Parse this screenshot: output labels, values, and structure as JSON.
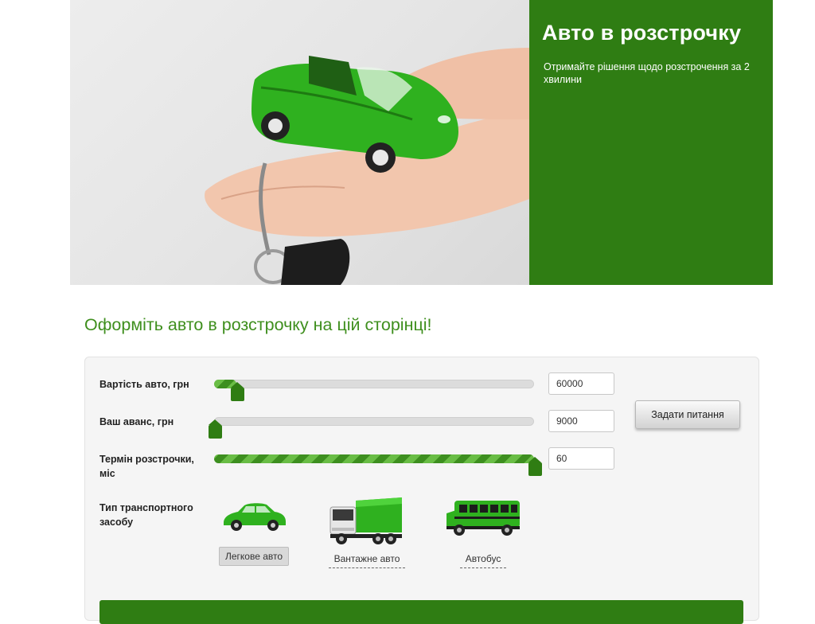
{
  "hero": {
    "title": "Авто в розстрочку",
    "subtitle": "Отримайте рішення щодо розстрочення за 2 хвилини",
    "panel_color": "#2f7d13"
  },
  "page": {
    "section_title": "Оформіть авто в розстрочку на цій сторінці!"
  },
  "calculator": {
    "car_price": {
      "label": "Вартість авто, грн",
      "value": "60000",
      "fill_fraction": 0.07
    },
    "down_payment": {
      "label": "Ваш аванс, грн",
      "value": "9000",
      "fill_fraction": 0.0
    },
    "term": {
      "label": "Термін розстрочки, міс",
      "value": "60",
      "fill_fraction": 1.0
    },
    "ask_button": "Задати питання",
    "vehicle_type_label": "Тип транспортного засобу",
    "vehicles": [
      {
        "label": "Легкове авто",
        "icon": "car-icon",
        "selected": true
      },
      {
        "label": "Вантажне авто",
        "icon": "truck-icon",
        "selected": false
      },
      {
        "label": "Автобус",
        "icon": "bus-icon",
        "selected": false
      }
    ]
  },
  "colors": {
    "accent": "#2f7d13",
    "title_green": "#3f8f1e",
    "slider_light": "#69bd45"
  }
}
